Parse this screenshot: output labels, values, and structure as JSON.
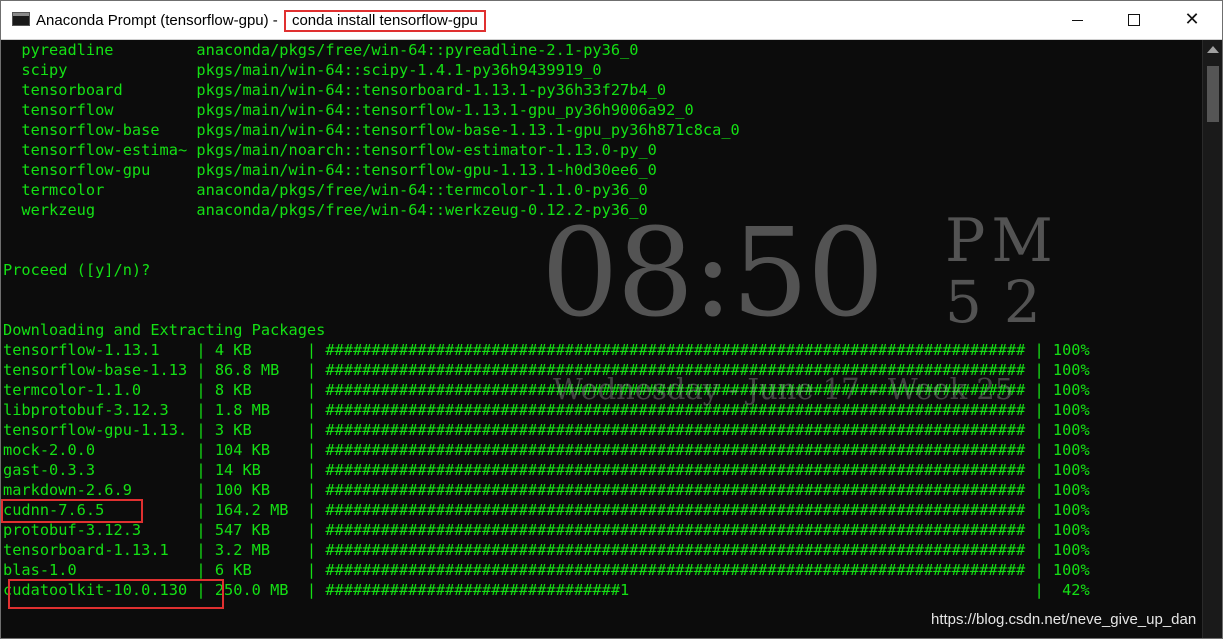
{
  "window": {
    "title": "Anaconda Prompt (tensorflow-gpu) -",
    "title_command": "conda  install tensorflow-gpu",
    "minimize_glyph": "",
    "maximize_glyph": "",
    "close_glyph": "✕"
  },
  "console": {
    "lines": [
      "  pyreadline         anaconda/pkgs/free/win-64::pyreadline-2.1-py36_0",
      "  scipy              pkgs/main/win-64::scipy-1.4.1-py36h9439919_0",
      "  tensorboard        pkgs/main/win-64::tensorboard-1.13.1-py36h33f27b4_0",
      "  tensorflow         pkgs/main/win-64::tensorflow-1.13.1-gpu_py36h9006a92_0",
      "  tensorflow-base    pkgs/main/win-64::tensorflow-base-1.13.1-gpu_py36h871c8ca_0",
      "  tensorflow-estima~ pkgs/main/noarch::tensorflow-estimator-1.13.0-py_0",
      "  tensorflow-gpu     pkgs/main/win-64::tensorflow-gpu-1.13.1-h0d30ee6_0",
      "  termcolor          anaconda/pkgs/free/win-64::termcolor-1.1.0-py36_0",
      "  werkzeug           anaconda/pkgs/free/win-64::werkzeug-0.12.2-py36_0",
      "",
      "",
      "Proceed ([y]/n)?",
      "",
      "",
      "Downloading and Extracting Packages",
      "tensorflow-1.13.1    | 4 KB      | ############################################################################ | 100%",
      "tensorflow-base-1.13 | 86.8 MB   | ############################################################################ | 100%",
      "termcolor-1.1.0      | 8 KB      | ############################################################################ | 100%",
      "libprotobuf-3.12.3   | 1.8 MB    | ############################################################################ | 100%",
      "tensorflow-gpu-1.13. | 3 KB      | ############################################################################ | 100%",
      "mock-2.0.0           | 104 KB    | ############################################################################ | 100%",
      "gast-0.3.3           | 14 KB     | ############################################################################ | 100%",
      "markdown-2.6.9       | 100 KB    | ############################################################################ | 100%",
      "cudnn-7.6.5          | 164.2 MB  | ############################################################################ | 100%",
      "protobuf-3.12.3      | 547 KB    | ############################################################################ | 100%",
      "tensorboard-1.13.1   | 3.2 MB    | ############################################################################ | 100%",
      "blas-1.0             | 6 KB      | ############################################################################ | 100%",
      "cudatoolkit-10.0.130 | 250.0 MB  | ################################1                                            |  42%"
    ]
  },
  "overlay": {
    "time": "08:50",
    "ampm": "PM",
    "seconds": "52",
    "date": "Wednesday - June 17 - Week 25"
  },
  "watermark": "https://blog.csdn.net/neve_give_up_dan",
  "colors": {
    "console_bg": "#0c0c0c",
    "console_text": "#14e014",
    "highlight": "#e03030"
  }
}
